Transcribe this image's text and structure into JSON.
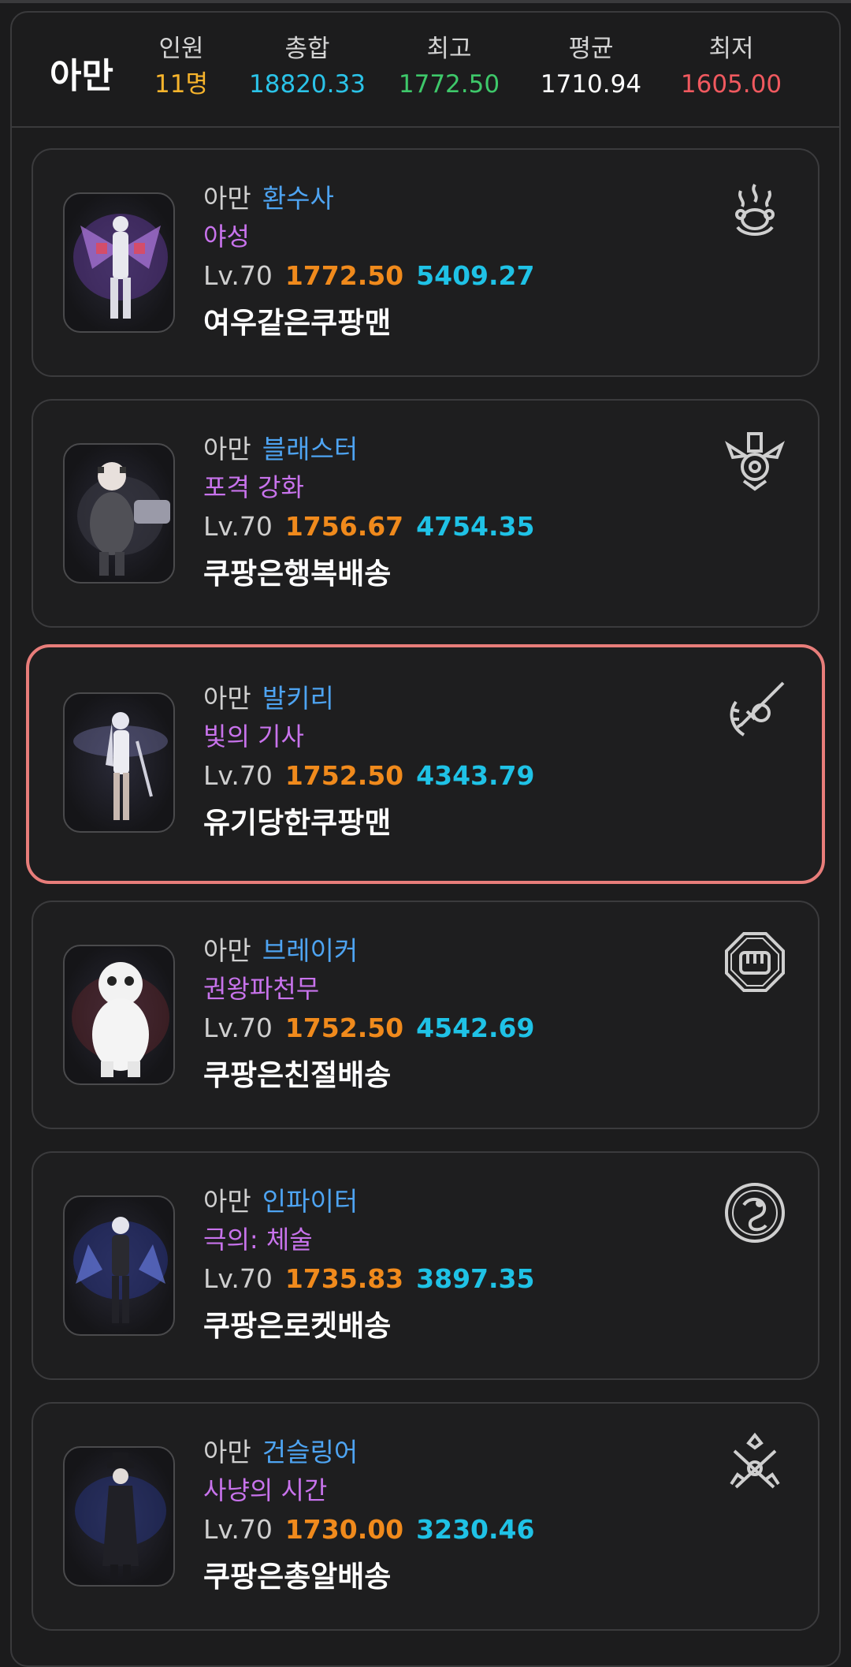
{
  "header": {
    "server": "아만",
    "stats": [
      {
        "label": "인원",
        "value": "11명",
        "color": "#f7b42c"
      },
      {
        "label": "총합",
        "value": "18820.33",
        "color": "#2bc3e8"
      },
      {
        "label": "최고",
        "value": "1772.50",
        "color": "#3ec86a"
      },
      {
        "label": "평균",
        "value": "1710.94",
        "color": "#ffffff"
      },
      {
        "label": "최저",
        "value": "1605.00",
        "color": "#f0595f"
      }
    ]
  },
  "characters": [
    {
      "server": "아만",
      "class": "환수사",
      "spec": "야성",
      "level": "Lv.70",
      "item_level": "1772.50",
      "combat_power": "5409.27",
      "name": "여우같은쿠팡맨",
      "icon": "paw-flame-icon",
      "selected": false
    },
    {
      "server": "아만",
      "class": "블래스터",
      "spec": "포격 강화",
      "level": "Lv.70",
      "item_level": "1756.67",
      "combat_power": "4754.35",
      "name": "쿠팡은행복배송",
      "icon": "cannon-emblem-icon",
      "selected": false
    },
    {
      "server": "아만",
      "class": "발키리",
      "spec": "빛의 기사",
      "level": "Lv.70",
      "item_level": "1752.50",
      "combat_power": "4343.79",
      "name": "유기당한쿠팡맨",
      "icon": "sword-wreath-icon",
      "selected": true
    },
    {
      "server": "아만",
      "class": "브레이커",
      "spec": "권왕파천무",
      "level": "Lv.70",
      "item_level": "1752.50",
      "combat_power": "4542.69",
      "name": "쿠팡은친절배송",
      "icon": "fist-octagon-icon",
      "selected": false
    },
    {
      "server": "아만",
      "class": "인파이터",
      "spec": "극의: 체술",
      "level": "Lv.70",
      "item_level": "1735.83",
      "combat_power": "3897.35",
      "name": "쿠팡은로켓배송",
      "icon": "dragon-circle-icon",
      "selected": false
    },
    {
      "server": "아만",
      "class": "건슬링어",
      "spec": "사냥의 시간",
      "level": "Lv.70",
      "item_level": "1730.00",
      "combat_power": "3230.46",
      "name": "쿠팡은총알배송",
      "icon": "crossed-guns-icon",
      "selected": false
    }
  ]
}
